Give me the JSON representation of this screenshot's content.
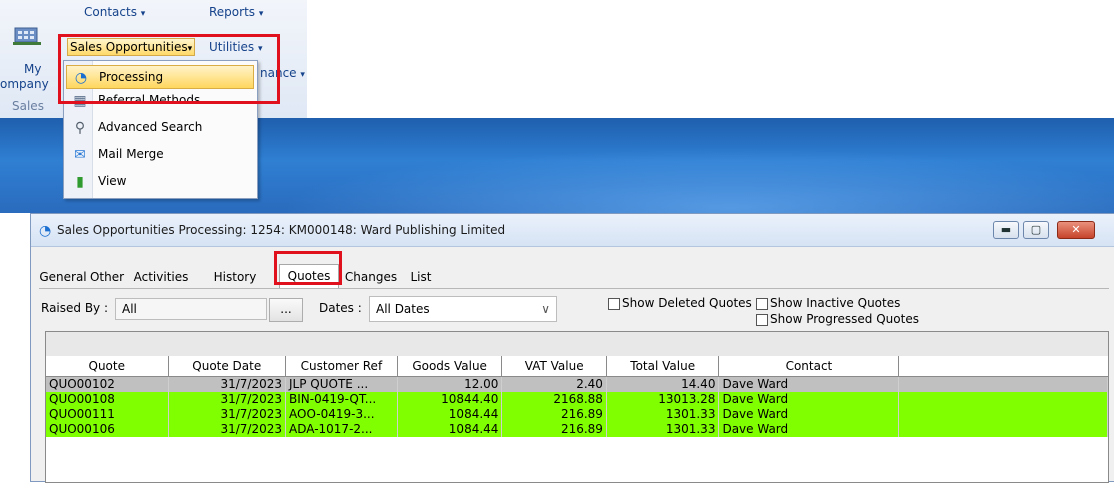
{
  "ribbon": {
    "contacts_label": "Contacts",
    "reports_label": "Reports",
    "sales_opportunities_label": "Sales Opportunities",
    "utilities_label": "Utilities",
    "my_label": "My",
    "company_label": "ompany",
    "sales_group_label": "Sales",
    "maintenance_partial": "nance",
    "arrow": "▾"
  },
  "menu": {
    "items": [
      {
        "label": "Processing",
        "icon": "processing-icon"
      },
      {
        "label": "Referral Methods",
        "icon": "referral-icon"
      },
      {
        "label": "Advanced Search",
        "icon": "advanced-search-icon"
      },
      {
        "label": "Mail Merge",
        "icon": "mail-merge-icon"
      },
      {
        "label": "View",
        "icon": "view-chart-icon"
      }
    ]
  },
  "window": {
    "title": "Sales Opportunities Processing: 1254: KM000148: Ward Publishing Limited",
    "minimize": "▬",
    "maximize": "▢",
    "close": "✕",
    "tabs": [
      "General",
      "Other",
      "Activities",
      "History",
      "Quotes",
      "Changes",
      "List"
    ],
    "active_tab": "Quotes"
  },
  "filters": {
    "raised_by_label": "Raised By :",
    "raised_by_value": "All",
    "browse_button": "...",
    "dates_label": "Dates :",
    "dates_value": "All Dates",
    "dropdown_arrow": "∨",
    "show_deleted_quotes": "Show Deleted Quotes",
    "show_inactive_quotes": "Show Inactive Quotes",
    "show_progressed_quotes": "Show Progressed Quotes"
  },
  "grid": {
    "columns": [
      "Quote",
      "Quote Date",
      "Customer Ref",
      "Goods Value",
      "VAT Value",
      "Total Value",
      "Contact"
    ],
    "rows": [
      {
        "quote": "QUO00102",
        "date": "31/7/2023",
        "ref": "JLP QUOTE ...",
        "goods": "12.00",
        "vat": "2.40",
        "total": "14.40",
        "contact": "Dave Ward",
        "color": "#c0c0c0"
      },
      {
        "quote": "QUO00108",
        "date": "31/7/2023",
        "ref": "BIN-0419-QT...",
        "goods": "10844.40",
        "vat": "2168.88",
        "total": "13013.28",
        "contact": "Dave Ward",
        "color": "#80ff00"
      },
      {
        "quote": "QUO00111",
        "date": "31/7/2023",
        "ref": "AOO-0419-3...",
        "goods": "1084.44",
        "vat": "216.89",
        "total": "1301.33",
        "contact": "Dave Ward",
        "color": "#80ff00"
      },
      {
        "quote": "QUO00106",
        "date": "31/7/2023",
        "ref": "ADA-1017-2...",
        "goods": "1084.44",
        "vat": "216.89",
        "total": "1301.33",
        "contact": "Dave Ward",
        "color": "#80ff00"
      }
    ]
  },
  "colors": {
    "highlight_red": "#e0101c",
    "row_grey": "#c0c0c0",
    "row_green": "#80ff00"
  }
}
